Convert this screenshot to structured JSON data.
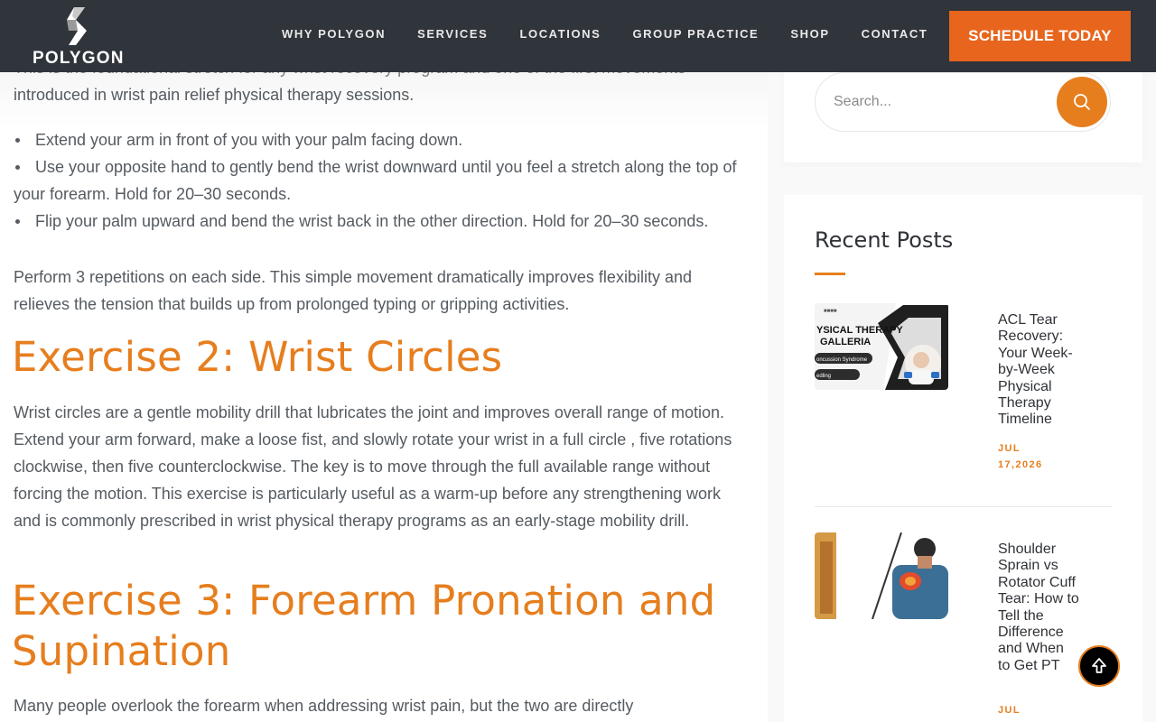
{
  "header": {
    "logo_text": "POLYGON",
    "nav": [
      "WHY POLYGON",
      "SERVICES",
      "LOCATIONS",
      "GROUP PRACTICE",
      "SHOP",
      "CONTACT"
    ],
    "cta_label": "SCHEDULE TODAY"
  },
  "article": {
    "intro_cut": "This is the foundational stretch for any wrist recovery program and one of the first movements",
    "intro": "introduced in wrist pain relief physical therapy sessions.",
    "bullets": [
      "Extend your arm in front of you with your palm facing down.",
      "Use your opposite hand to gently bend the wrist downward until you feel a stretch along the top of your forearm. Hold for 20–30 seconds.",
      "Flip your palm upward and bend the wrist back in the other direction. Hold for 20–30 seconds."
    ],
    "perform": "Perform 3 repetitions on each side. This simple movement dramatically improves flexibility and relieves the tension that builds up from prolonged typing or gripping activities.",
    "exercise2_heading": "Exercise 2: Wrist Circles",
    "exercise2_text": "Wrist circles are a gentle mobility drill that lubricates the joint and improves overall range of motion. Extend your arm forward, make a loose fist, and slowly rotate your wrist in a full circle , five rotations clockwise, then five counterclockwise. The key is to move through the full available range without forcing the motion. This exercise is particularly useful as a warm-up before any strengthening work and is commonly prescribed in wrist physical therapy programs as an early-stage mobility drill.",
    "exercise3_heading": "Exercise 3: Forearm Pronation and Supination",
    "exercise3_text": "Many people overlook the forearm when addressing wrist pain, but the two are directly"
  },
  "sidebar": {
    "search_placeholder": "Search...",
    "recent_posts_title": "Recent Posts",
    "posts": [
      {
        "title": "ACL Tear Recovery: Your Week-by-Week Physical Therapy Timeline",
        "date": "JUL 17,2026",
        "thumb_text_1": "YSICAL THERAPY",
        "thumb_text_2": "GALLERIA",
        "thumb_text_3": "oncussion Syndrome",
        "thumb_text_4": "edling"
      },
      {
        "title": "Shoulder Sprain vs Rotator Cuff Tear: How to Tell the Difference and When to Get PT",
        "date": "JUL"
      }
    ]
  },
  "colors": {
    "accent": "#e67e1e",
    "cta": "#e8651d",
    "header_bg": "#30343b"
  }
}
